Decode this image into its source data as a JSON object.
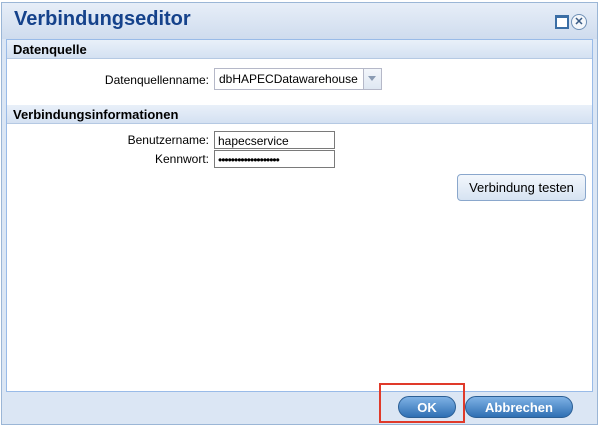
{
  "window": {
    "title": "Verbindungseditor"
  },
  "datasource": {
    "header": "Datenquelle",
    "name_label": "Datenquellenname:",
    "name_value": "dbHAPECDatawarehouse"
  },
  "connection": {
    "header": "Verbindungsinformationen",
    "username_label": "Benutzername:",
    "username_value": "hapecservice",
    "password_label": "Kennwort:",
    "password_value": "•••••••••••••••••••",
    "test_button": "Verbindung testen"
  },
  "footer": {
    "ok_label": "OK",
    "cancel_label": "Abbrechen"
  },
  "icons": {
    "maximize": "maximize-icon",
    "close": "close-icon",
    "dropdown": "chevron-down-icon"
  },
  "colors": {
    "title": "#15428b",
    "highlight": "#e03a2a",
    "button_blue": "#2f6fb3"
  }
}
